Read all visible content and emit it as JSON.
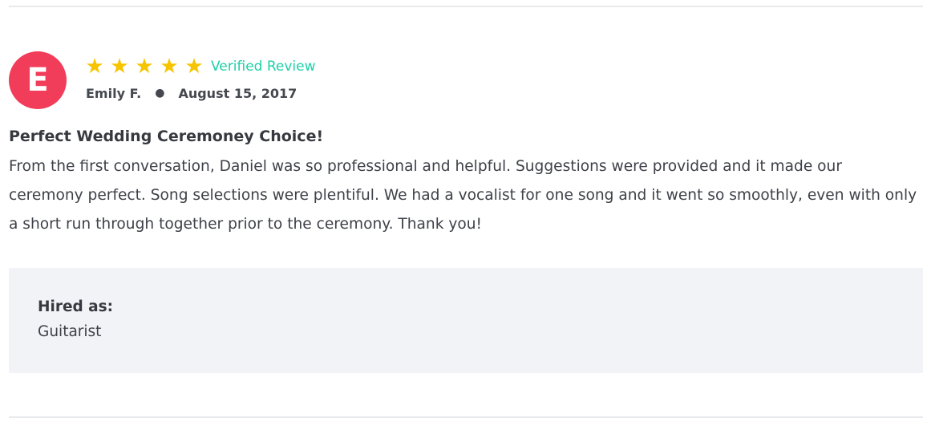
{
  "review": {
    "avatar_letter": "E",
    "avatar_color": "#f23d5a",
    "rating": 5,
    "rating_max": 5,
    "star_glyph": "★",
    "star_color": "#f7c400",
    "verified_label": "Verified Review",
    "verified_color": "#1fd0a8",
    "author": "Emily F.",
    "separator": "●",
    "date": "August 15, 2017",
    "title": "Perfect Wedding Ceremoney Choice!",
    "body_lines": [
      "From the first conversation, Daniel was so professional and helpful. Suggestions were provided and it made our",
      "ceremony perfect. Song selections were plentiful. We had a vocalist for one song and it went so smoothly, even with only",
      "a short run through together prior to the ceremony. Thank you!"
    ],
    "hired_as_label": "Hired as:",
    "hired_as_value": "Guitarist"
  }
}
